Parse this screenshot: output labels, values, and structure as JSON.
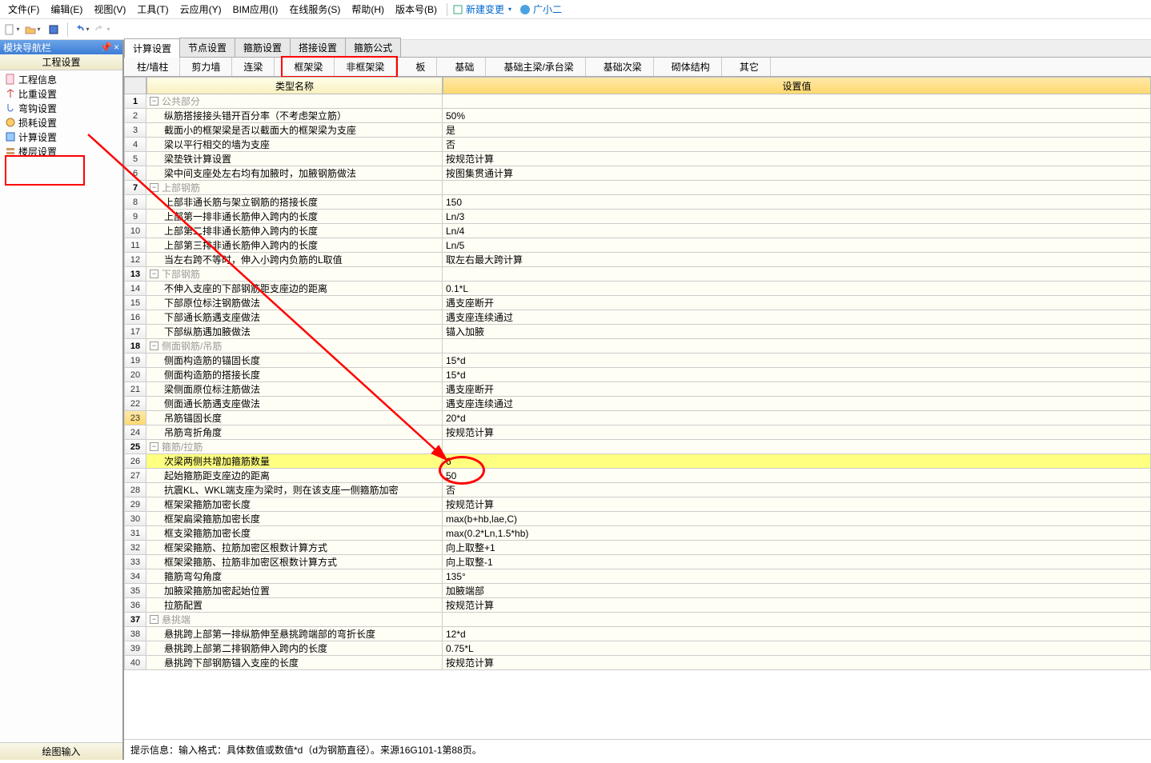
{
  "menu": {
    "items": [
      "文件(F)",
      "编辑(E)",
      "视图(V)",
      "工具(T)",
      "云应用(Y)",
      "BIM应用(I)",
      "在线服务(S)",
      "帮助(H)",
      "版本号(B)"
    ],
    "new_change": "新建变更",
    "helper": "广小二"
  },
  "sidebar": {
    "title": "模块导航栏",
    "section": "工程设置",
    "items": [
      {
        "label": "工程信息"
      },
      {
        "label": "比重设置"
      },
      {
        "label": "弯钩设置"
      },
      {
        "label": "损耗设置"
      },
      {
        "label": "计算设置"
      },
      {
        "label": "楼层设置"
      }
    ],
    "footer": "绘图输入"
  },
  "tabs": [
    "计算设置",
    "节点设置",
    "箍筋设置",
    "搭接设置",
    "箍筋公式"
  ],
  "subtabs": [
    "柱/墙柱",
    "剪力墙",
    "连梁",
    "",
    "框架梁",
    "非框架梁",
    "",
    "板",
    "",
    "基础",
    "",
    "基础主梁/承台梁",
    "",
    "基础次梁",
    "",
    "砌体结构",
    "",
    "其它"
  ],
  "headers": {
    "name": "类型名称",
    "val": "设置值"
  },
  "rows": [
    {
      "n": 1,
      "t": "s",
      "name": "公共部分",
      "val": ""
    },
    {
      "n": 2,
      "name": "纵筋搭接接头错开百分率（不考虑架立筋）",
      "val": "50%"
    },
    {
      "n": 3,
      "name": "截面小的框架梁是否以截面大的框架梁为支座",
      "val": "是"
    },
    {
      "n": 4,
      "name": "梁以平行相交的墙为支座",
      "val": "否"
    },
    {
      "n": 5,
      "name": "梁垫铁计算设置",
      "val": "按规范计算"
    },
    {
      "n": 6,
      "name": "梁中间支座处左右均有加腋时，加腋钢筋做法",
      "val": "按图集贯通计算"
    },
    {
      "n": 7,
      "t": "s",
      "name": "上部钢筋",
      "val": ""
    },
    {
      "n": 8,
      "name": "上部非通长筋与架立钢筋的搭接长度",
      "val": "150"
    },
    {
      "n": 9,
      "name": "上部第一排非通长筋伸入跨内的长度",
      "val": "Ln/3"
    },
    {
      "n": 10,
      "name": "上部第二排非通长筋伸入跨内的长度",
      "val": "Ln/4"
    },
    {
      "n": 11,
      "name": "上部第三排非通长筋伸入跨内的长度",
      "val": "Ln/5"
    },
    {
      "n": 12,
      "name": "当左右跨不等时，伸入小跨内负筋的L取值",
      "val": "取左右最大跨计算"
    },
    {
      "n": 13,
      "t": "s",
      "name": "下部钢筋",
      "val": ""
    },
    {
      "n": 14,
      "name": "不伸入支座的下部钢筋距支座边的距离",
      "val": "0.1*L"
    },
    {
      "n": 15,
      "name": "下部原位标注钢筋做法",
      "val": "遇支座断开"
    },
    {
      "n": 16,
      "name": "下部通长筋遇支座做法",
      "val": "遇支座连续通过"
    },
    {
      "n": 17,
      "name": "下部纵筋遇加腋做法",
      "val": "锚入加腋"
    },
    {
      "n": 18,
      "t": "s",
      "name": "侧面钢筋/吊筋",
      "val": ""
    },
    {
      "n": 19,
      "name": "侧面构造筋的锚固长度",
      "val": "15*d"
    },
    {
      "n": 20,
      "name": "侧面构造筋的搭接长度",
      "val": "15*d"
    },
    {
      "n": 21,
      "name": "梁侧面原位标注筋做法",
      "val": "遇支座断开"
    },
    {
      "n": 22,
      "name": "侧面通长筋遇支座做法",
      "val": "遇支座连续通过"
    },
    {
      "n": 23,
      "hl": true,
      "name": "吊筋锚固长度",
      "val": "20*d"
    },
    {
      "n": 24,
      "name": "吊筋弯折角度",
      "val": "按规范计算"
    },
    {
      "n": 25,
      "t": "s",
      "name": "箍筋/拉筋",
      "val": ""
    },
    {
      "n": 26,
      "sel": true,
      "name": "次梁两侧共增加箍筋数量",
      "val": "6"
    },
    {
      "n": 27,
      "name": "起始箍筋距支座边的距离",
      "val": "50"
    },
    {
      "n": 28,
      "name": "抗震KL、WKL端支座为梁时，则在该支座一侧箍筋加密",
      "val": "否"
    },
    {
      "n": 29,
      "name": "框架梁箍筋加密长度",
      "val": "按规范计算"
    },
    {
      "n": 30,
      "name": "框架扁梁箍筋加密长度",
      "val": "max(b+hb,lae,C)"
    },
    {
      "n": 31,
      "name": "框支梁箍筋加密长度",
      "val": "max(0.2*Ln,1.5*hb)"
    },
    {
      "n": 32,
      "name": "框架梁箍筋、拉筋加密区根数计算方式",
      "val": "向上取整+1"
    },
    {
      "n": 33,
      "name": "框架梁箍筋、拉筋非加密区根数计算方式",
      "val": "向上取整-1"
    },
    {
      "n": 34,
      "name": "箍筋弯勾角度",
      "val": "135°"
    },
    {
      "n": 35,
      "name": "加腋梁箍筋加密起始位置",
      "val": "加腋端部"
    },
    {
      "n": 36,
      "name": "拉筋配置",
      "val": "按规范计算"
    },
    {
      "n": 37,
      "t": "s",
      "name": "悬挑端",
      "val": ""
    },
    {
      "n": 38,
      "name": "悬挑跨上部第一排纵筋伸至悬挑跨端部的弯折长度",
      "val": "12*d"
    },
    {
      "n": 39,
      "name": "悬挑跨上部第二排钢筋伸入跨内的长度",
      "val": "0.75*L"
    },
    {
      "n": 40,
      "name": "悬挑跨下部钢筋锚入支座的长度",
      "val": "按规范计算"
    }
  ],
  "hint": "提示信息：输入格式：具体数值或数值*d（d为钢筋直径）。来源16G101-1第88页。"
}
